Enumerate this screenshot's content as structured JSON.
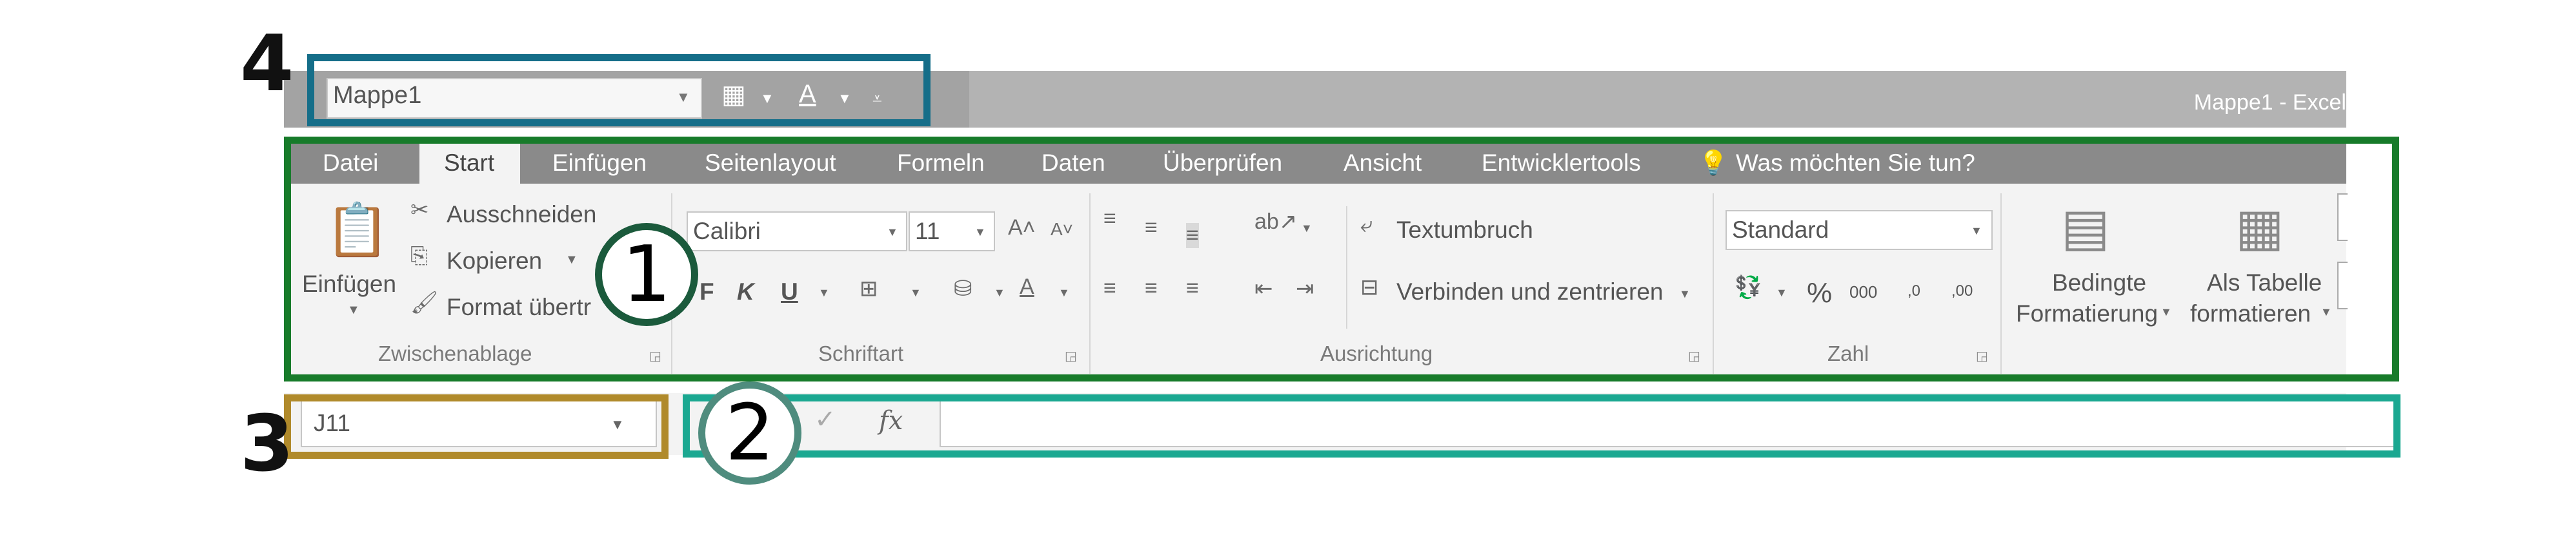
{
  "window": {
    "title": "Mappe1 - Excel"
  },
  "quick_access": {
    "workbook_label": "Mappe1",
    "icons": [
      "grid-icon",
      "font-color-icon",
      "customize-qat-icon"
    ]
  },
  "tabs": [
    "Datei",
    "Start",
    "Einfügen",
    "Seitenlayout",
    "Formeln",
    "Daten",
    "Überprüfen",
    "Ansicht",
    "Entwicklertools"
  ],
  "search": {
    "text": "Was möchten Sie tun?"
  },
  "clipboard": {
    "paste": "Einfügen",
    "cut": "Ausschneiden",
    "copy": "Kopieren",
    "format": "Format übertr",
    "group": "Zwischenablage"
  },
  "font": {
    "name": "Calibri",
    "size": "11",
    "bold": "F",
    "italic": "K",
    "underline": "U",
    "group": "Schriftart"
  },
  "alignment": {
    "wrap": "Textumbruch",
    "merge": "Verbinden und zentrieren",
    "group": "Ausrichtung"
  },
  "number": {
    "format": "Standard",
    "percent": "%",
    "thousands": "000",
    "inc_dec": ",0",
    "dec_dec": ",00",
    "group": "Zahl"
  },
  "styles": {
    "conditional_1": "Bedingte",
    "conditional_2": "Formatierung",
    "table_1": "Als Tabelle",
    "table_2": "formatieren"
  },
  "formula_bar": {
    "namebox": "J11",
    "fx": "fx"
  },
  "callouts": {
    "one": "1",
    "two": "2",
    "three": "3",
    "four": "4"
  },
  "colors": {
    "frame1": "#177b2a",
    "frame2": "#1ba891",
    "frame3": "#b08a2b",
    "frame4": "#156e89"
  }
}
